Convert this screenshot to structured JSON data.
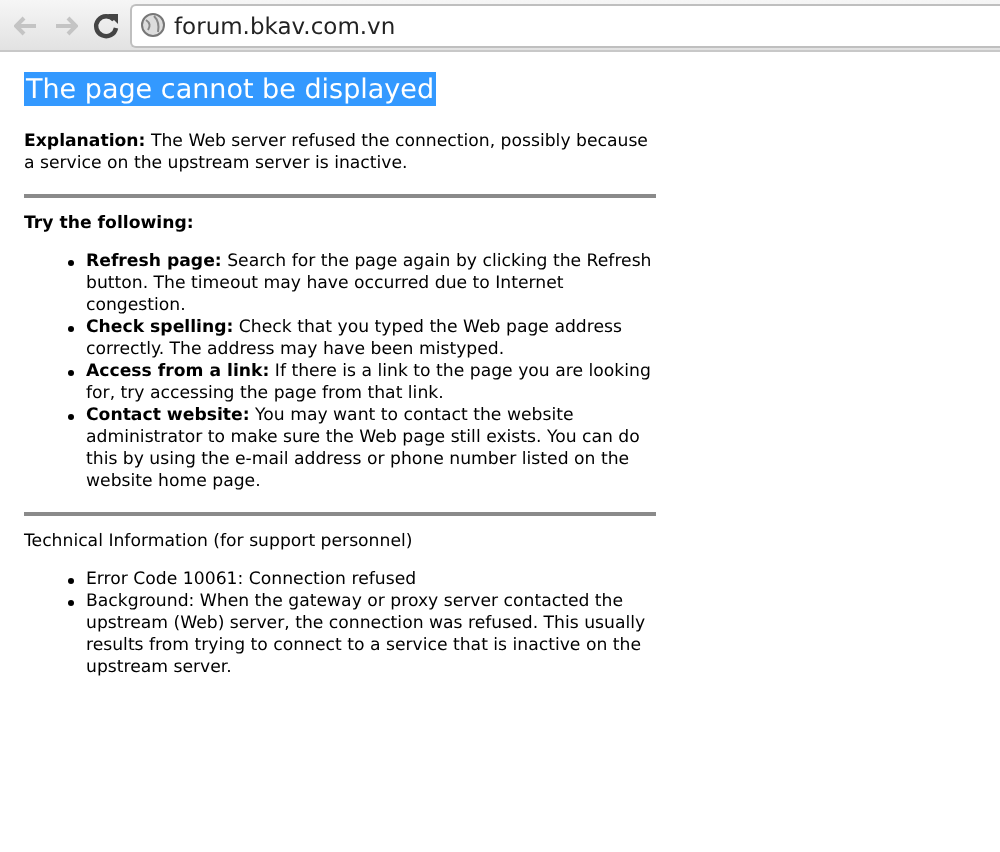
{
  "browser": {
    "url": "forum.bkav.com.vn",
    "back_disabled": true,
    "forward_disabled": true
  },
  "page": {
    "title": "The page cannot be displayed",
    "title_selected": true,
    "explanation": "**Explanation:** The Web server refused the connection, possibly because a service on the upstream server is inactive.",
    "try_heading": "Try the following:",
    "suggestions": [
      "**Refresh page:** Search for the page again by clicking the Refresh button. The timeout may have occurred due to Internet congestion.",
      "**Check spelling:** Check that you typed the Web page address correctly. The address may have been mistyped.",
      "**Access from a link:** If there is a link to the page you are looking for, try accessing the page from that link.",
      "**Contact website:** You may want to contact the website administrator to make sure the Web page still exists. You can do this by using the e-mail address or phone number listed on the website home page."
    ],
    "tech_heading": "Technical Information (for support personnel)",
    "tech_items": [
      "Error Code 10061: Connection refused",
      "Background: When the gateway or proxy server contacted the upstream (Web) server, the connection was refused. This usually results from trying to connect to a service that is inactive on the upstream server."
    ]
  }
}
